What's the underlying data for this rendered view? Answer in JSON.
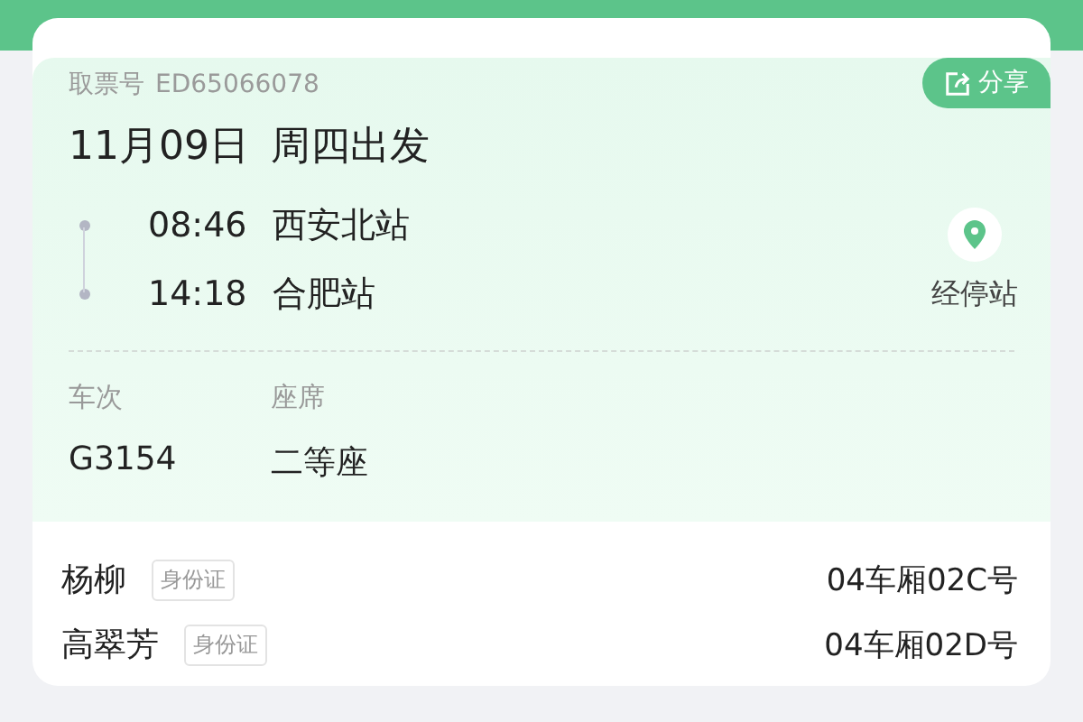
{
  "ticket": {
    "pickup_label": "取票号",
    "pickup_code": "ED65066078",
    "share": "分享",
    "date": "11月09日",
    "weekday": "周四出发",
    "stops": [
      {
        "time": "08:46",
        "station": "西安北站"
      },
      {
        "time": "14:18",
        "station": "合肥站"
      }
    ],
    "stopover": "经停站",
    "fields": [
      {
        "label": "车次",
        "value": "G3154"
      },
      {
        "label": "座席",
        "value": "二等座"
      }
    ]
  },
  "passengers": [
    {
      "name": "杨柳",
      "id_type": "身份证",
      "seat": "04车厢02C号"
    },
    {
      "name": "高翠芳",
      "id_type": "身份证",
      "seat": "04车厢02D号"
    }
  ]
}
